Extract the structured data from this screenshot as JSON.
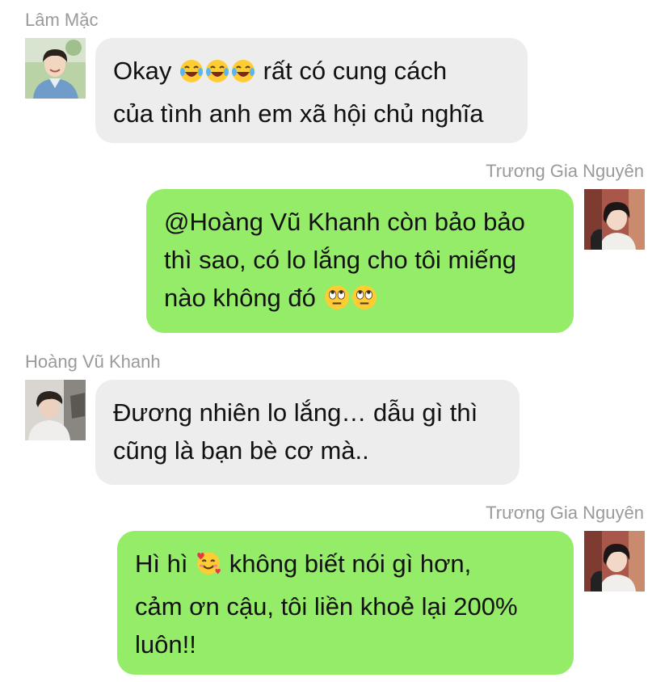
{
  "messages": [
    {
      "sender": "Lâm Mặc",
      "direction": "incoming",
      "avatar": "young-man-denim-jacket-avatar",
      "lines": [
        "Okay",
        "rất có cung cách",
        "của tình anh em xã hội chủ nghĩa"
      ],
      "emojis": [
        "tears-of-joy-emoji",
        "tears-of-joy-emoji",
        "tears-of-joy-emoji"
      ]
    },
    {
      "sender": "Trương Gia Nguyên",
      "direction": "outgoing",
      "avatar": "young-man-dark-hair-avatar",
      "lines": [
        "@Hoàng Vũ Khanh còn bảo bảo",
        "thì sao, có lo lắng cho tôi miếng",
        "nào không đó"
      ],
      "emojis": [
        "eye-roll-emoji",
        "eye-roll-emoji"
      ]
    },
    {
      "sender": "Hoàng Vũ Khanh",
      "direction": "incoming",
      "avatar": "young-man-cap-avatar",
      "lines": [
        "Đương nhiên lo lắng… dẫu gì thì",
        "cũng là bạn bè cơ mà.."
      ]
    },
    {
      "sender": "Trương Gia Nguyên",
      "direction": "outgoing",
      "avatar": "young-man-dark-hair-avatar",
      "lines": [
        "Hì hì",
        "không biết nói gì hơn,",
        "cảm ơn cậu, tôi liền khoẻ lại 200%",
        "luôn!!"
      ],
      "emojis": [
        "smiling-face-with-hearts-emoji"
      ]
    }
  ],
  "colors": {
    "incoming_bubble": "#ededed",
    "outgoing_bubble": "#95ec69",
    "sender_name": "#9a9a9a",
    "text": "#111111"
  }
}
